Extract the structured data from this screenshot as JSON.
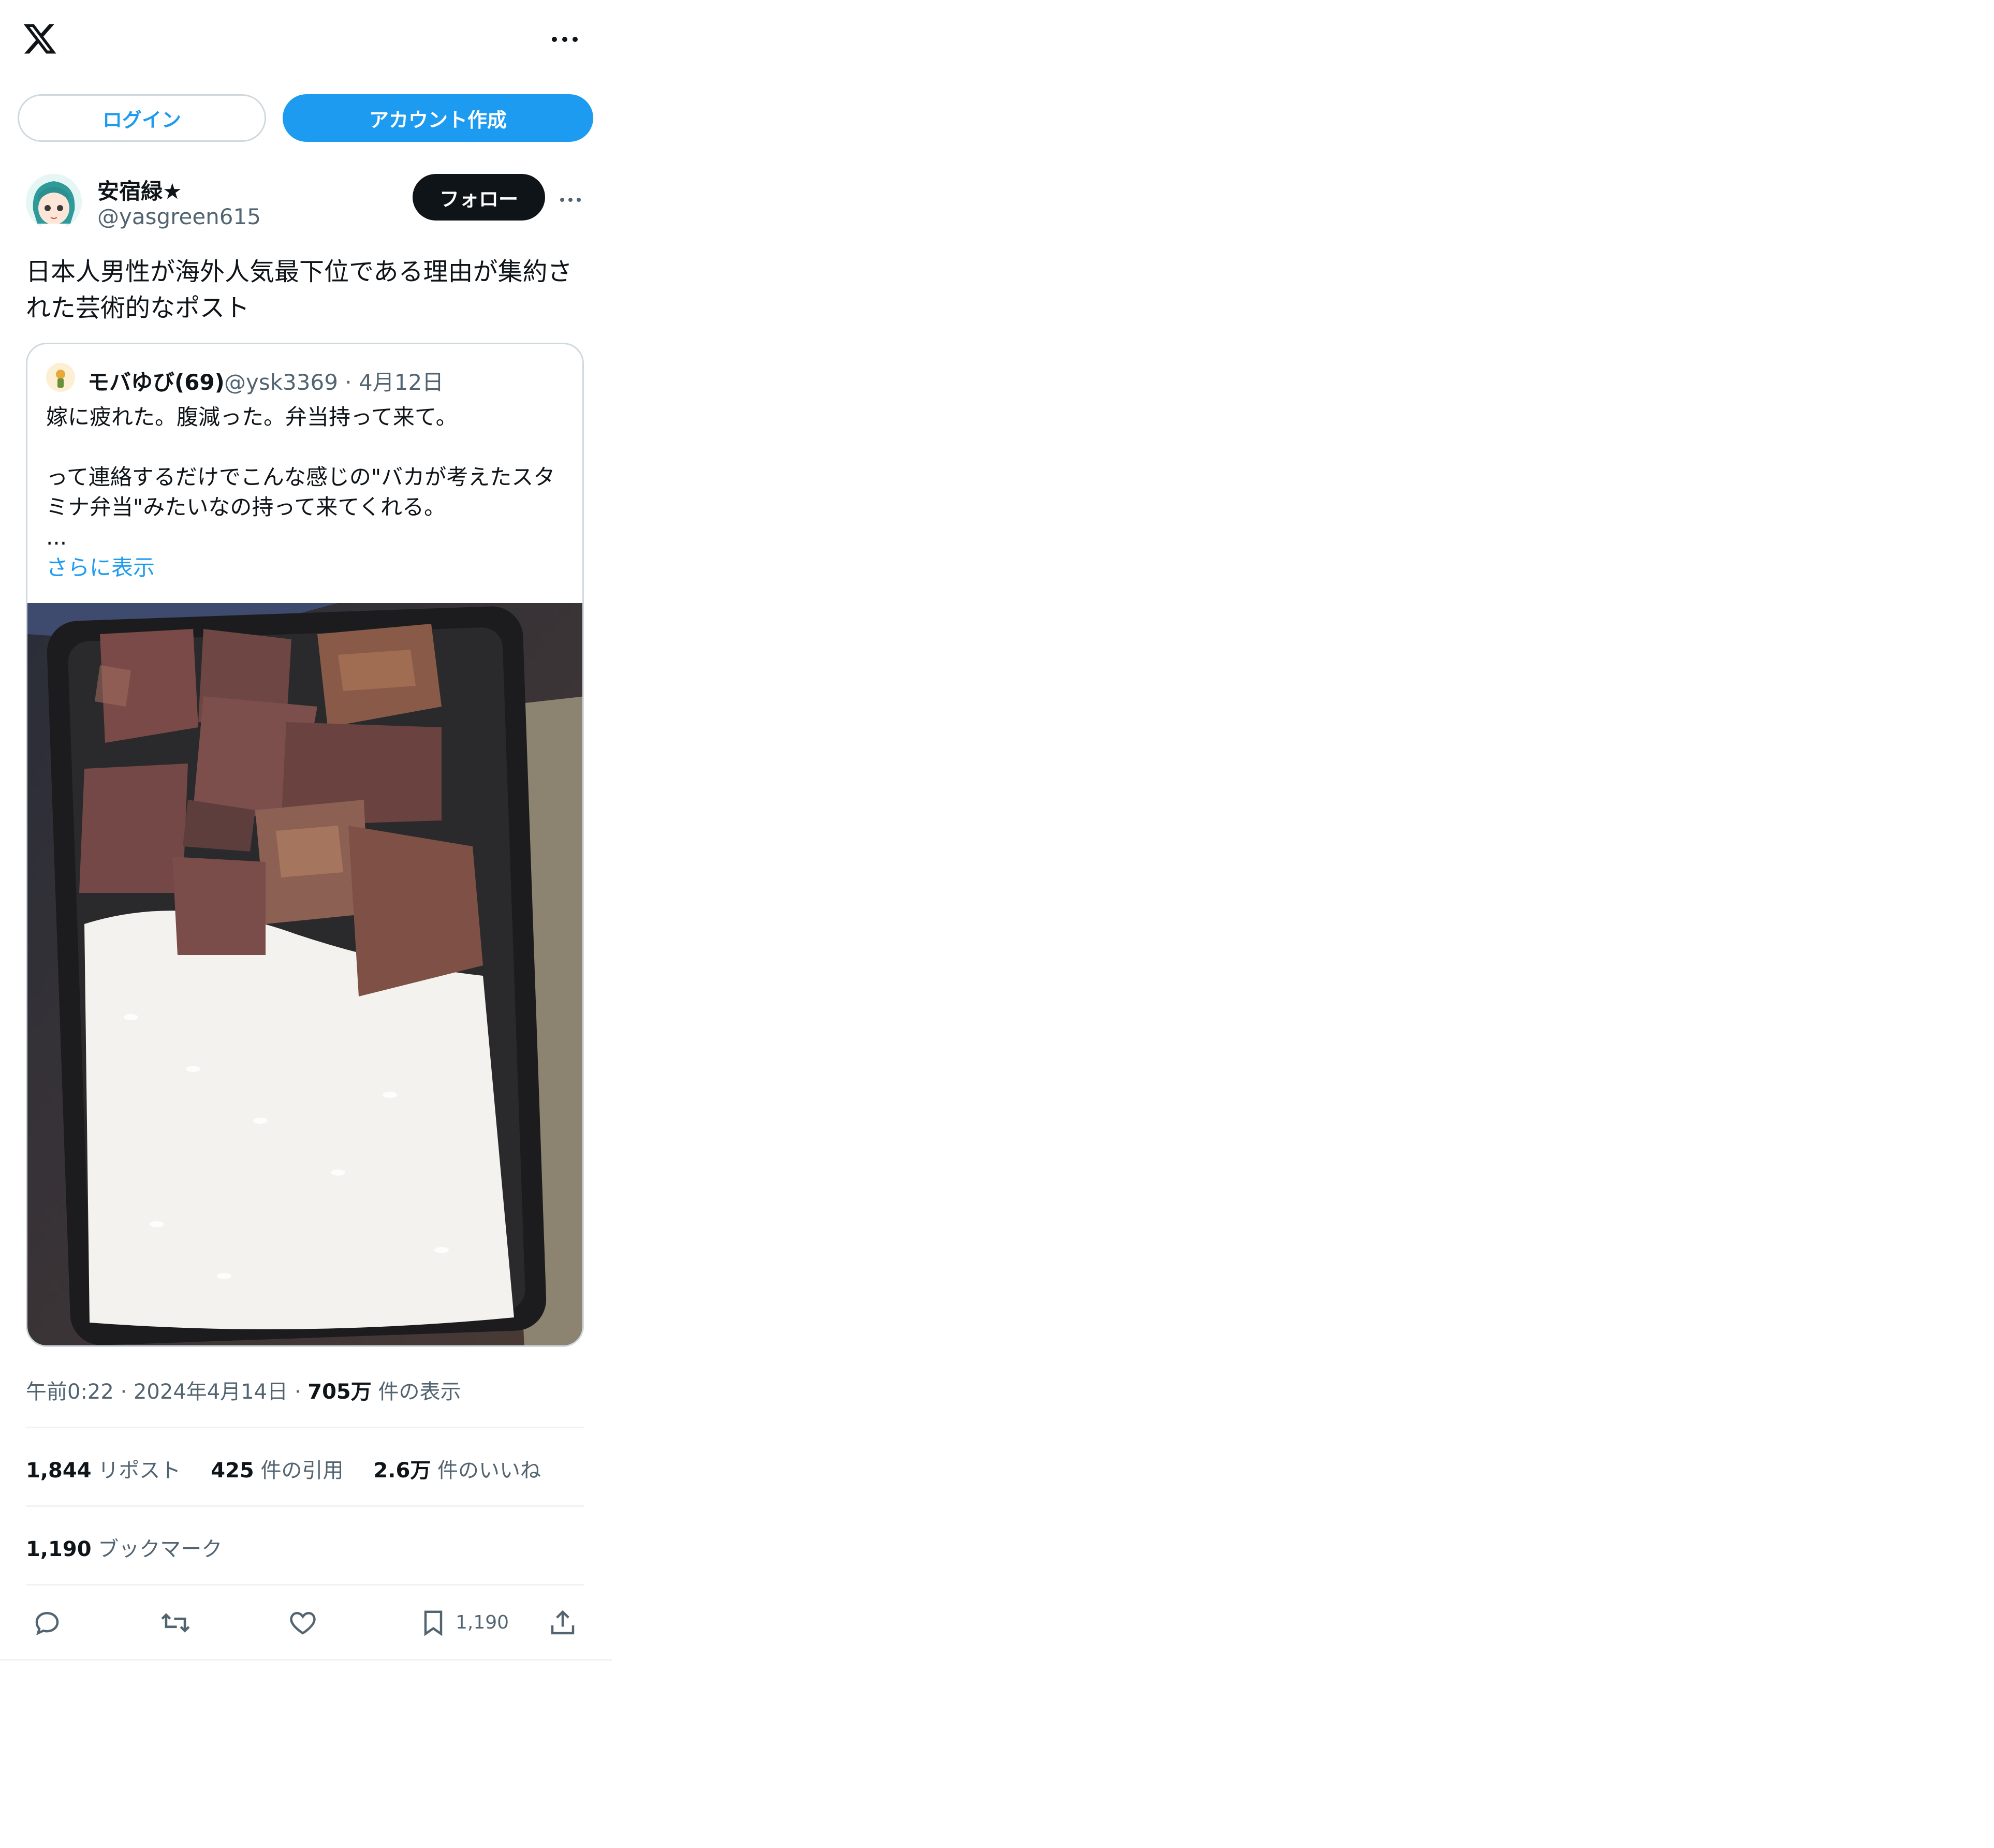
{
  "header": {
    "logo_icon": "x-logo-icon",
    "more_icon": "more-horizontal-icon",
    "login_label": "ログイン",
    "signup_label": "アカウント作成"
  },
  "author": {
    "name": "安宿緑★󠄀󠄀󠄀",
    "handle": "@yasgreen615",
    "follow_label": "フォロー"
  },
  "post": {
    "text": "日本人男性が海外人気最下位である理由が集約された芸術的なポスト"
  },
  "quote": {
    "name": "モバゆび(69)",
    "handle_date": "@ysk3369 · 4月12日",
    "text": "嫁に疲れた。腹減った。弁当持って来て。\n\nって連絡するだけでこんな感じの\"バカが考えたスタミナ弁当\"みたいなの持って来てくれる。\n...",
    "show_more": "さらに表示"
  },
  "meta": {
    "time": "午前0:22 · 2024年4月14日 · ",
    "views_count": "705万",
    "views_label": " 件の表示"
  },
  "stats": {
    "reposts_count": "1,844",
    "reposts_label": " リポスト",
    "quotes_count": "425",
    "quotes_label": " 件の引用",
    "likes_count": "2.6万",
    "likes_label": " 件のいいね",
    "bookmarks_count": "1,190",
    "bookmarks_label": " ブックマーク"
  },
  "actions": {
    "reply_icon": "reply-icon",
    "repost_icon": "repost-icon",
    "like_icon": "heart-icon",
    "bookmark_icon": "bookmark-icon",
    "bookmark_count": "1,190",
    "share_icon": "share-icon"
  },
  "colors": {
    "accent": "#1d9bf0",
    "text": "#0f1419",
    "secondary": "#536471",
    "border": "#cfd9de"
  }
}
